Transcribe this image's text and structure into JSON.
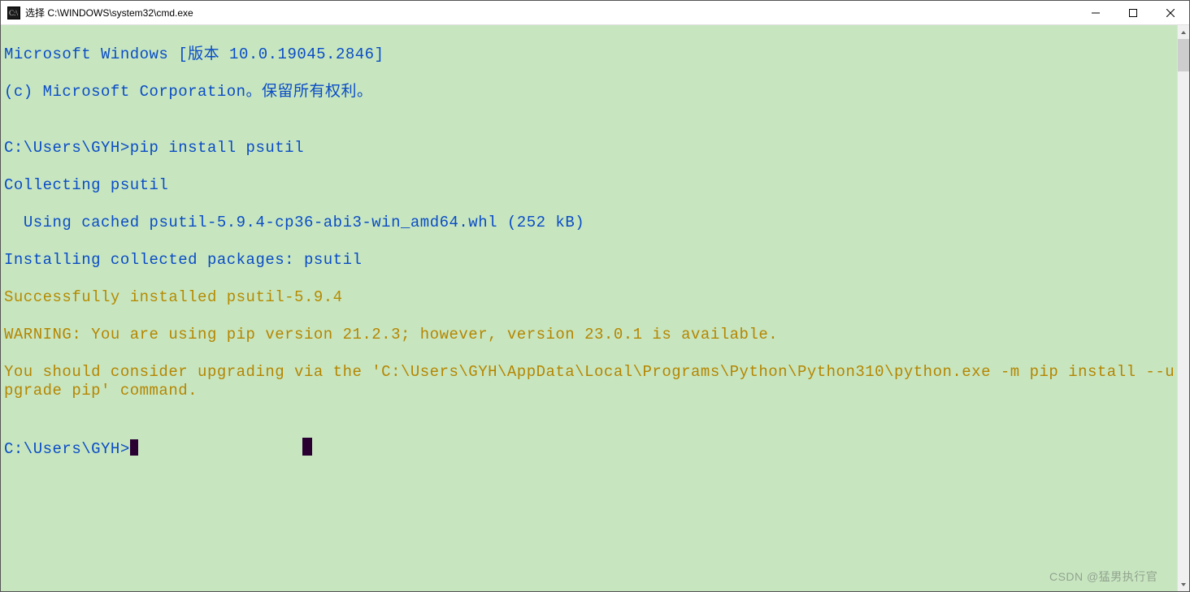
{
  "window": {
    "title": "选择 C:\\WINDOWS\\system32\\cmd.exe"
  },
  "colors": {
    "background": "#c7e6c0",
    "blue": "#0a4cc5",
    "olive": "#b58a00",
    "dark": "#2a0033"
  },
  "terminal": {
    "line1": "Microsoft Windows [版本 10.0.19045.2846]",
    "line2": "(c) Microsoft Corporation。保留所有权利。",
    "blank1": "",
    "prompt1_path": "C:\\Users\\GYH>",
    "prompt1_cmd": "pip install psutil",
    "collecting": "Collecting psutil",
    "using_cached": "  Using cached psutil-5.9.4-cp36-abi3-win_amd64.whl (252 kB)",
    "installing": "Installing collected packages: psutil",
    "success": "Successfully installed psutil-5.9.4",
    "warn_l1": "WARNING: You are using pip version 21.2.3; however, version 23.0.1 is available.",
    "warn_l2": "You should consider upgrading via the 'C:\\Users\\GYH\\AppData\\Local\\Programs\\Python\\Python310\\python.exe -m pip install --upgrade pip' command.",
    "blank2": "",
    "prompt2_path": "C:\\Users\\GYH>",
    "selection_spacer": "                 "
  },
  "watermark": "CSDN @猛男执行官"
}
